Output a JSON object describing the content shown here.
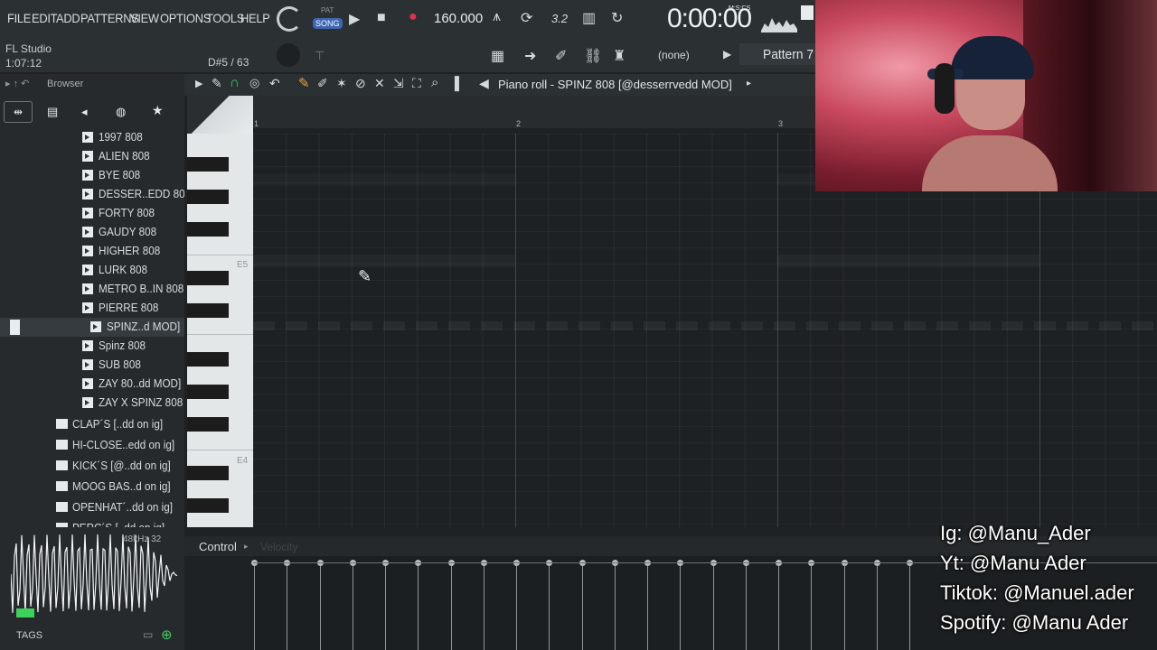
{
  "menu": [
    "FILE",
    "EDIT",
    "ADD",
    "PATTERNS",
    "VIEW",
    "OPTIONS",
    "TOOLS",
    "HELP"
  ],
  "transport": {
    "pat_label": "PAT",
    "song_label": "SONG",
    "tempo": "160.000",
    "time": "0:00:00",
    "time_unit": "M:S:CS",
    "counter": "3.2"
  },
  "app": {
    "name": "FL Studio",
    "version": "1:07:12"
  },
  "hint": "D#5 / 63",
  "pattern": {
    "name": "Pattern 7",
    "channel": "(none)"
  },
  "browser": {
    "title": "Browser",
    "folders": [
      "1997 808",
      "ALIEN 808",
      "BYE 808",
      "DESSER..EDD 808",
      "FORTY 808",
      "GAUDY 808",
      "HIGHER 808",
      "LURK 808",
      "METRO B..IN 808",
      "PIERRE 808"
    ],
    "selected": "SPINZ..d MOD]",
    "folders2": [
      "Spinz 808",
      "SUB 808",
      "ZAY 80..dd MOD]",
      "ZAY X SPINZ 808"
    ],
    "kits": [
      "CLAP´S [..dd on ig]",
      "HI-CLOSE..edd on ig]",
      "KICK´S [@..dd on ig]",
      "MOOG BAS..d on ig]",
      "OPENHAT´..dd on ig]",
      "PERC´S [..dd on ig]"
    ],
    "sample_info": "48kHz 32",
    "tags_label": "TAGS"
  },
  "piano_roll": {
    "title": "Piano roll - SPINZ 808 [@desserrvedd MOD]",
    "bars": [
      "1",
      "2",
      "3"
    ],
    "note_labels": [
      "E5",
      "E4"
    ]
  },
  "control": {
    "label": "Control",
    "velocity_label": "Velocity"
  },
  "socials": [
    "Ig: @Manu_Ader",
    "Yt: @Manu Ader",
    "Tiktok: @Manuel.ader",
    "Spotify: @Manu Ader"
  ],
  "colors": {
    "accent_green": "#3bd15c",
    "record_red": "#e0334a",
    "webcam_glow": "#e0546c"
  }
}
